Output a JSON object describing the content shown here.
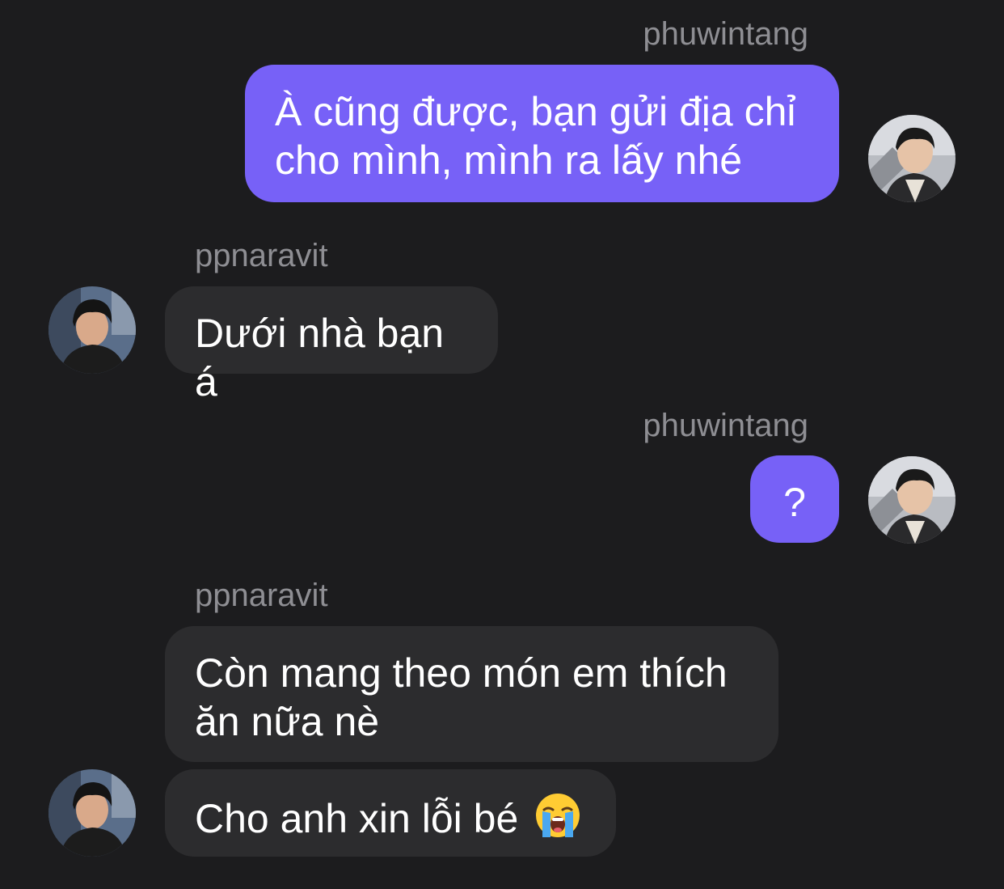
{
  "conversation": {
    "messages": [
      {
        "sender": "phuwintang",
        "text_line1": "À cũng được, bạn gửi địa chỉ",
        "text_line2": "cho mình, mình ra lấy nhé"
      },
      {
        "sender": "ppnaravit",
        "text": "Dưới nhà bạn á"
      },
      {
        "sender": "phuwintang",
        "text": "?"
      },
      {
        "sender": "ppnaravit",
        "text_line1": "Còn mang theo món em thích",
        "text_line2": "ăn nữa nè"
      },
      {
        "text": "Cho anh xin lỗi bé",
        "emoji": "loudly-crying-face"
      }
    ]
  },
  "colors": {
    "background": "#1c1c1e",
    "outgoing_bubble": "#7761f7",
    "incoming_bubble": "#2c2c2e",
    "sender_name": "#8e8e93",
    "text": "#ffffff"
  }
}
